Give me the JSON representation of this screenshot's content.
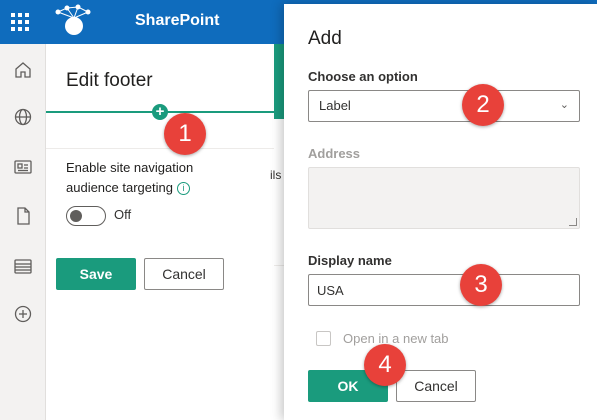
{
  "app": {
    "brand": "SharePoint"
  },
  "rail": {
    "icons": [
      "home-icon",
      "globe-icon",
      "news-icon",
      "document-icon",
      "list-icon",
      "add-icon"
    ]
  },
  "footer_panel": {
    "title": "Edit footer",
    "toggle_label": "Enable site navigation audience targeting",
    "toggle_state": "Off",
    "save_label": "Save",
    "cancel_label": "Cancel"
  },
  "background": {
    "partial_text": "ils"
  },
  "dialog": {
    "title": "Add",
    "option_label": "Choose an option",
    "option_value": "Label",
    "address_label": "Address",
    "display_name_label": "Display name",
    "display_name_value": "USA",
    "new_tab_label": "Open in a new tab",
    "ok_label": "OK",
    "cancel_label": "Cancel"
  },
  "annotations": [
    "1",
    "2",
    "3",
    "4"
  ],
  "colors": {
    "accent": "#1a9b7d",
    "topbar": "#0f6cbd",
    "badge": "#e8413a"
  }
}
